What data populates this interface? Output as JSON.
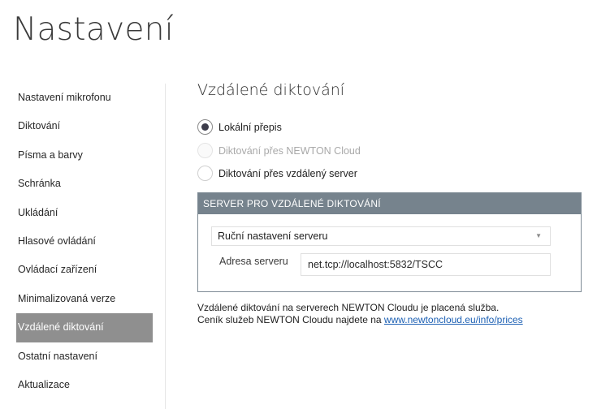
{
  "page": {
    "title": "Nastavení"
  },
  "sidebar": {
    "items": [
      {
        "label": "Nastavení mikrofonu"
      },
      {
        "label": "Diktování"
      },
      {
        "label": "Písma a barvy"
      },
      {
        "label": "Schránka"
      },
      {
        "label": "Ukládání"
      },
      {
        "label": "Hlasové ovládání"
      },
      {
        "label": "Ovládací zařízení"
      },
      {
        "label": "Minimalizovaná verze"
      },
      {
        "label": "Vzdálené diktování",
        "active": true
      },
      {
        "label": "Ostatní nastavení"
      },
      {
        "label": "Aktualizace"
      }
    ]
  },
  "main": {
    "title": "Vzdálené diktování",
    "options": [
      {
        "label": "Lokální přepis",
        "checked": true,
        "enabled": true
      },
      {
        "label": "Diktování přes NEWTON Cloud",
        "checked": false,
        "enabled": false
      },
      {
        "label": "Diktování přes vzdálený server",
        "checked": false,
        "enabled": true
      }
    ],
    "server_group": {
      "header": "SERVER PRO VZDÁLENÉ DIKTOVÁNÍ",
      "mode_selected": "Ruční nastavení serveru",
      "address_label": "Adresa serveru",
      "address_value": "net.tcp://localhost:5832/TSCC"
    },
    "info": {
      "line1": "Vzdálené diktování na serverech NEWTON Cloudu je placená služba.",
      "line2_prefix": "Ceník služeb NEWTON Cloudu najdete na ",
      "link": "www.newtoncloud.eu/info/prices"
    }
  },
  "colors": {
    "group_header": "#76838d",
    "active_item": "#8f8f8f",
    "link": "#1b5fb3"
  },
  "icons": {
    "dropdown": "chevron-down-icon"
  }
}
